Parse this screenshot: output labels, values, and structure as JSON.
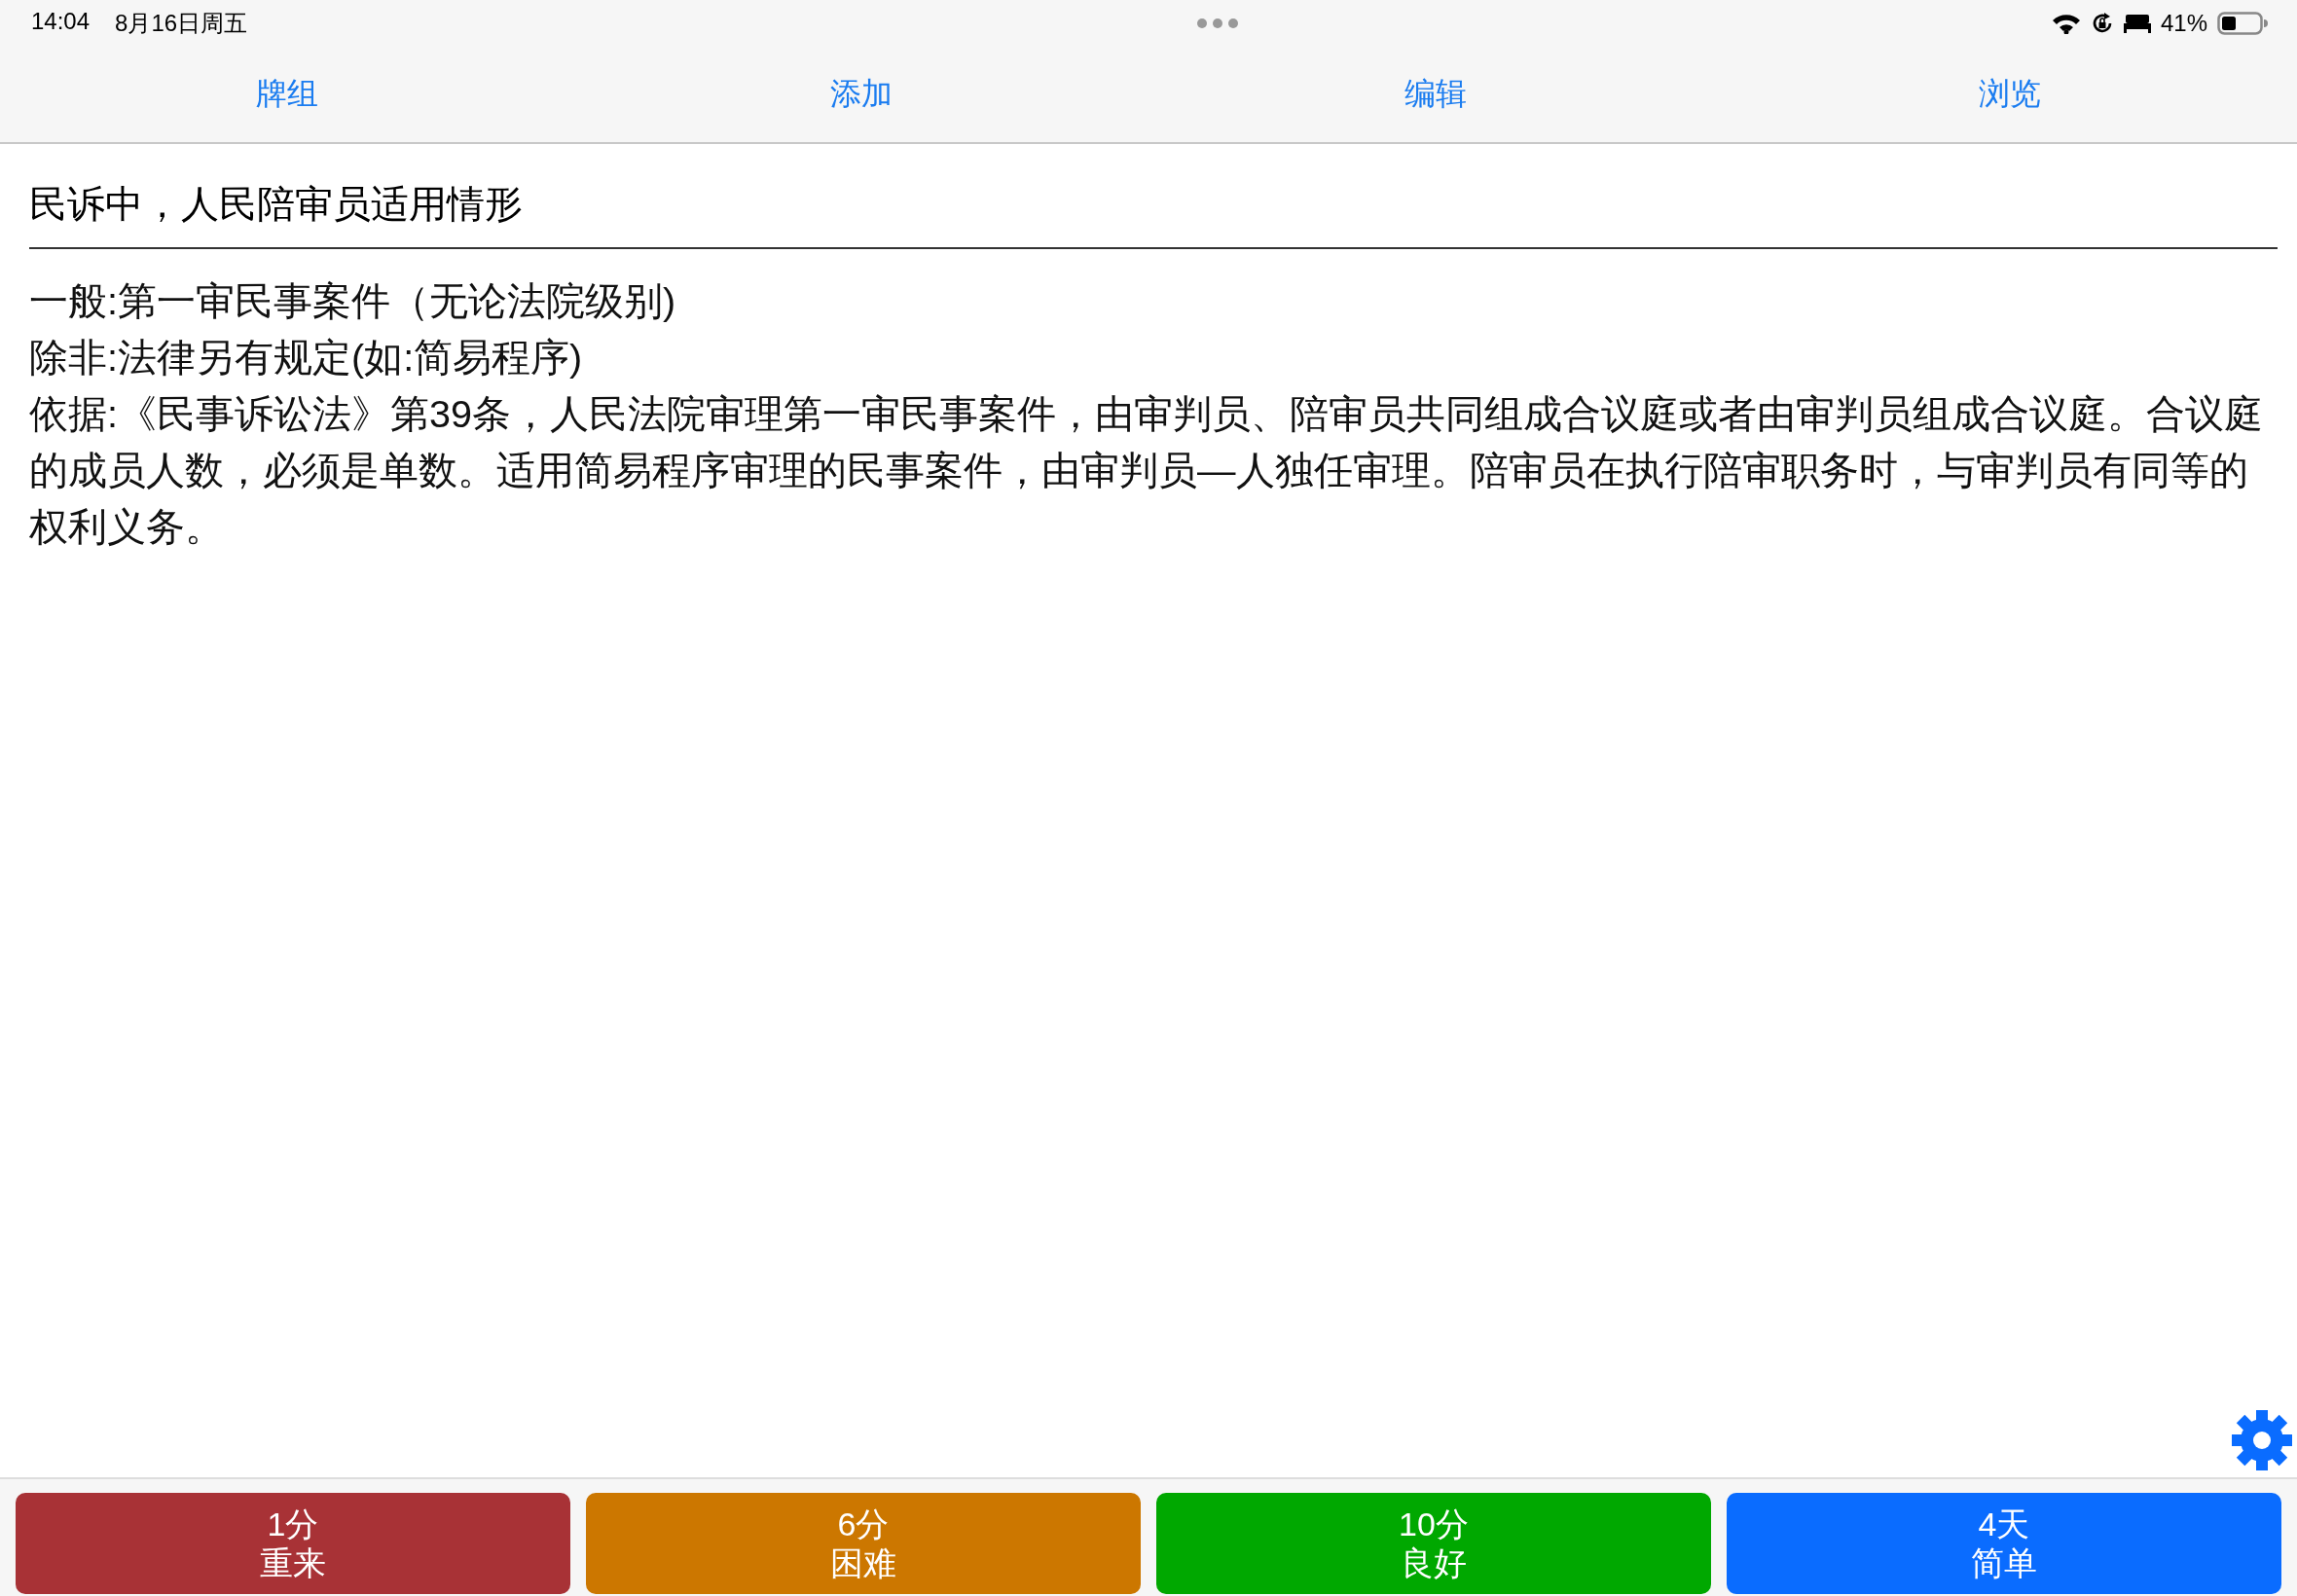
{
  "status_bar": {
    "time": "14:04",
    "date": "8月16日周五",
    "battery": "41%"
  },
  "tabs": [
    {
      "label": "牌组"
    },
    {
      "label": "添加"
    },
    {
      "label": "编辑"
    },
    {
      "label": "浏览"
    }
  ],
  "card": {
    "question": "民诉中，人民陪审员适用情形",
    "answer": [
      "一般:第一审民事案件（无论法院级别)",
      "除非:法律另有规定(如:简易程序)",
      "依据:《民事诉讼法》第39条，人民法院审理第一审民事案件，由审判员、陪审员共同组成合议庭或者由审判员组成合议庭。合议庭的成员人数，必须是单数。适用简易程序审理的民事案件，由审判员—人独任审理。陪审员在执行陪审职务时，与审判员有同等的权利义务。"
    ]
  },
  "answer_buttons": [
    {
      "interval": "1分",
      "label": "重来",
      "color": "#a83236"
    },
    {
      "interval": "6分",
      "label": "困难",
      "color": "#cc7700"
    },
    {
      "interval": "10分",
      "label": "良好",
      "color": "#00a800"
    },
    {
      "interval": "4天",
      "label": "简单",
      "color": "#0a6cff"
    }
  ]
}
